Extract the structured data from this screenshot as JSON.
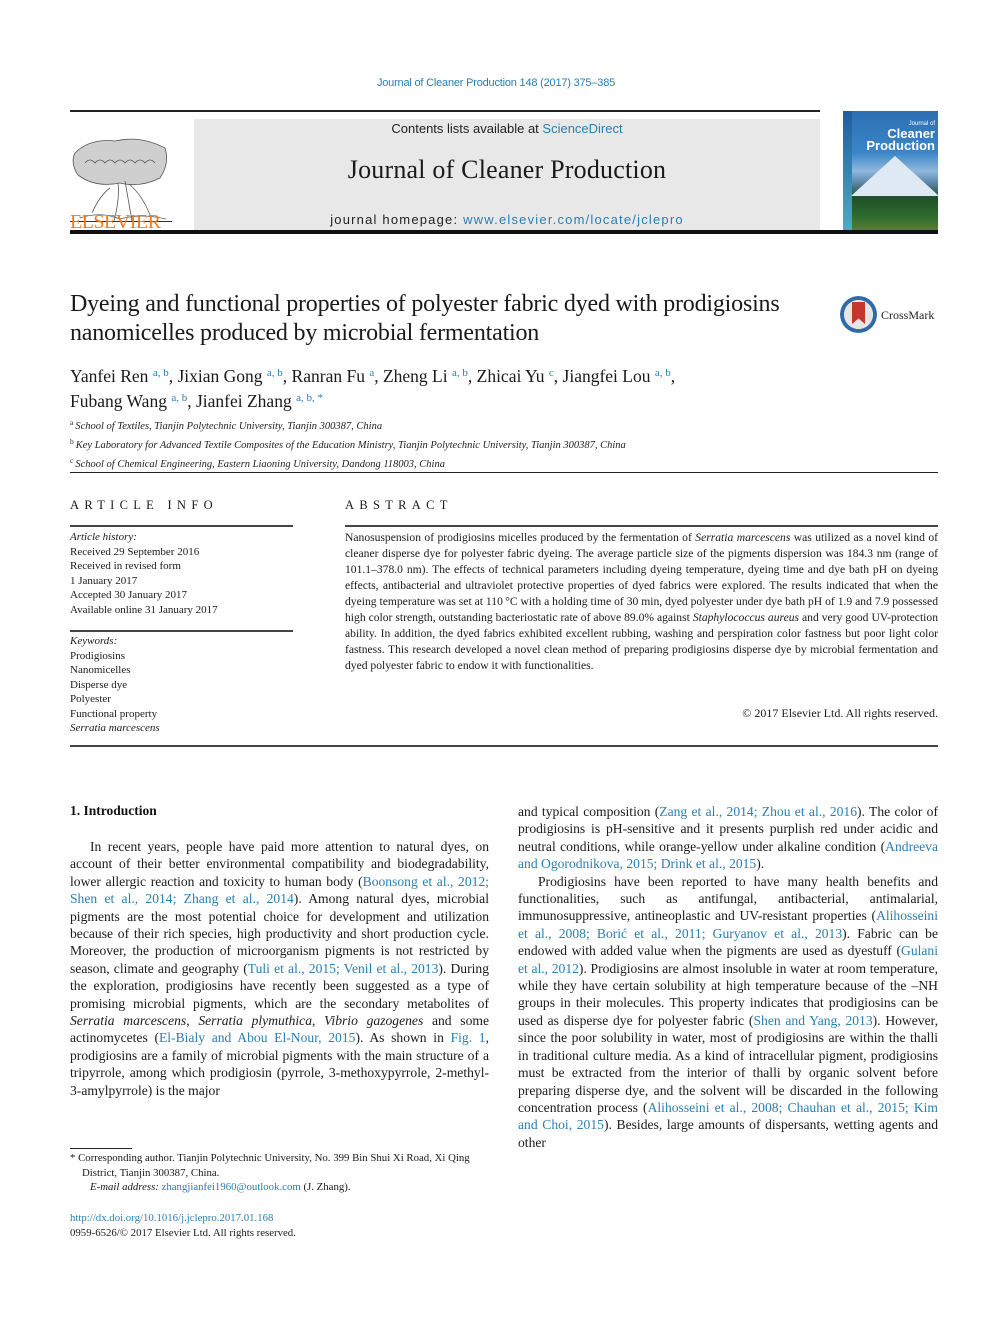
{
  "running_head": "Journal of Cleaner Production 148 (2017) 375–385",
  "masthead": {
    "contents_prefix": "Contents lists available at ",
    "contents_link": "ScienceDirect",
    "journal_title": "Journal of Cleaner Production",
    "homepage_prefix": "journal homepage: ",
    "homepage_link": "www.elsevier.com/locate/jclepro",
    "publisher_logo_text": "ELSEVIER",
    "publisher_color": "#f07a1a",
    "link_color": "#2a7fb0",
    "cover": {
      "sup": "Journal of",
      "line1": "Cleaner",
      "line2": "Production"
    }
  },
  "article": {
    "title": "Dyeing and functional properties of polyester fabric dyed with prodigiosins nanomicelles produced by microbial fermentation",
    "crossmark_label": "CrossMark",
    "authors": [
      {
        "name": "Yanfei Ren",
        "aff": "a, b"
      },
      {
        "name": "Jixian Gong",
        "aff": "a, b"
      },
      {
        "name": "Ranran Fu",
        "aff": "a"
      },
      {
        "name": "Zheng Li",
        "aff": "a, b"
      },
      {
        "name": "Zhicai Yu",
        "aff": "c"
      },
      {
        "name": "Jiangfei Lou",
        "aff": "a, b"
      },
      {
        "name": "Fubang Wang",
        "aff": "a, b"
      },
      {
        "name": "Jianfei Zhang",
        "aff": "a, b, *"
      }
    ],
    "affiliations": [
      {
        "key": "a",
        "text": "School of Textiles, Tianjin Polytechnic University, Tianjin 300387, China"
      },
      {
        "key": "b",
        "text": "Key Laboratory for Advanced Textile Composites of the Education Ministry, Tianjin Polytechnic University, Tianjin 300387, China"
      },
      {
        "key": "c",
        "text": "School of Chemical Engineering, Eastern Liaoning University, Dandong 118003, China"
      }
    ]
  },
  "article_info": {
    "heading": "ARTICLE INFO",
    "history_label": "Article history:",
    "history": [
      "Received 29 September 2016",
      "Received in revised form",
      "1 January 2017",
      "Accepted 30 January 2017",
      "Available online 31 January 2017"
    ],
    "keywords_label": "Keywords:",
    "keywords": [
      "Prodigiosins",
      "Nanomicelles",
      "Disperse dye",
      "Polyester",
      "Functional property",
      "Serratia marcescens"
    ]
  },
  "abstract": {
    "heading": "ABSTRACT",
    "segments": [
      {
        "t": "Nanosuspension of prodigiosins micelles produced by the fermentation of ",
        "i": false
      },
      {
        "t": "Serratia marcescens",
        "i": true
      },
      {
        "t": " was uti­lized as a novel kind of cleaner disperse dye for polyester fabric dyeing. The average particle size of the pigments dispersion was 184.3 nm (range of 101.1–378.0 nm). The effects of technical parameters including dyeing temperature, dyeing time and dye bath pH on dyeing effects, antibacterial and ultra­violet protective properties of dyed fabrics were explored. The results indicated that when the dyeing temperature was set at 110 °C with a holding time of 30 min, dyed polyester under dye bath pH of 1.9 and 7.9 possessed high color strength, outstanding bacteriostatic rate of above 89.0% against ",
        "i": false
      },
      {
        "t": "Staphylococcus aureus",
        "i": true
      },
      {
        "t": " and very good UV-protection ability. In addition, the dyed fabrics exhibited excellent rubbing, washing and perspiration color fastness but poor light color fastness. This research developed a novel clean method of preparing prodigiosins disperse dye by microbial fermentation and dyed polyester fabric to endow it with functionalities.",
        "i": false
      }
    ],
    "copyright": "© 2017 Elsevier Ltd. All rights reserved."
  },
  "introduction": {
    "heading": "1.  Introduction",
    "left_column": [
      [
        {
          "t": "In recent years, people have paid more attention to natural dyes, on account of their better environmental compatibility and biodegradability, lower allergic reaction and toxicity to human body (",
          "k": "text"
        },
        {
          "t": "Boonsong et al., 2012; Shen et al., 2014; Zhang et al., 2014",
          "k": "link"
        },
        {
          "t": "). Among natural dyes, microbial pigments are the most potential choice for development and utilization because of their rich spe­cies, high productivity and short production cycle. Moreover, the production of microorganism pigments is not restricted by season, climate and geography (",
          "k": "text"
        },
        {
          "t": "Tuli et al., 2015; Venil et al., 2013",
          "k": "link"
        },
        {
          "t": "). During the exploration, prodigiosins have recently been suggested as a type of promising microbial pigments, which are the secondary metabolites of ",
          "k": "text"
        },
        {
          "t": "Serratia marcescens",
          "k": "italic"
        },
        {
          "t": ", ",
          "k": "text"
        },
        {
          "t": "Serratia plymuthica",
          "k": "italic"
        },
        {
          "t": ", ",
          "k": "text"
        },
        {
          "t": "Vibrio gaz­ogenes",
          "k": "italic"
        },
        {
          "t": " and some actinomycetes (",
          "k": "text"
        },
        {
          "t": "El-Bialy and Abou El-Nour, 2015",
          "k": "link"
        },
        {
          "t": "). As shown in ",
          "k": "text"
        },
        {
          "t": "Fig. 1",
          "k": "link"
        },
        {
          "t": ", prodigiosins are a family of microbial pigments with the main structure of a tripyrrole, among which prodigiosin (pyrrole, 3-methoxypyrrole, 2-methyl-3-amylpyrrole) is the major",
          "k": "text"
        }
      ]
    ],
    "right_column": [
      [
        {
          "t": "and typical composition (",
          "k": "text"
        },
        {
          "t": "Zang et al., 2014; Zhou et al., 2016",
          "k": "link"
        },
        {
          "t": "). The color of prodigiosins is pH-sensitive and it presents purplish red under acidic and neutral conditions, while orange-yellow under alkaline condition (",
          "k": "text"
        },
        {
          "t": "Andreeva and Ogorodnikova, 2015; Drink et al., 2015",
          "k": "link"
        },
        {
          "t": ").",
          "k": "text"
        }
      ],
      [
        {
          "t": "Prodigiosins have been reported to have many health benefits and functionalities, such as antifungal, antibacterial, antimalarial, immunosuppressive, antineoplastic and UV-resistant properties (",
          "k": "text"
        },
        {
          "t": "Alihosseini et al., 2008; Borić et al., 2011; Guryanov et al., 2013",
          "k": "link"
        },
        {
          "t": "). Fabric can be endowed with added value when the pigments are used as dyestuff (",
          "k": "text"
        },
        {
          "t": "Gulani et al., 2012",
          "k": "link"
        },
        {
          "t": "). Prodigiosins are almost insoluble in water at room temperature, while they have certain solubility at high temperature because of the –NH groups in their molecules. This property indicates that prodigiosins can be used as disperse dye for polyester fabric (",
          "k": "text"
        },
        {
          "t": "Shen and Yang, 2013",
          "k": "link"
        },
        {
          "t": "). However, since the poor solubility in water, most of prodigiosins are within the thalli in traditional culture media. As a kind of intracellular pigment, prodigiosins must be extracted from the interior of thalli by organic solvent before preparing disperse dye, and the solvent will be discarded in the following concentration process (",
          "k": "text"
        },
        {
          "t": "Alihosseini et al., 2008; Chauhan et al., 2015; Kim and Choi, 2015",
          "k": "link"
        },
        {
          "t": "). Besides, large amounts of dispersants, wetting agents and other",
          "k": "text"
        }
      ]
    ]
  },
  "footnotes": {
    "corresponding": "* Corresponding author. Tianjin Polytechnic University, No. 399 Bin Shui Xi Road, Xi Qing District, Tianjin 300387, China.",
    "email_label": "E-mail address:",
    "email": "zhangjianfei1960@outlook.com",
    "email_suffix": " (J. Zhang).",
    "doi": "http://dx.doi.org/10.1016/j.jclepro.2017.01.168",
    "issn_line": "0959-6526/© 2017 Elsevier Ltd. All rights reserved."
  }
}
